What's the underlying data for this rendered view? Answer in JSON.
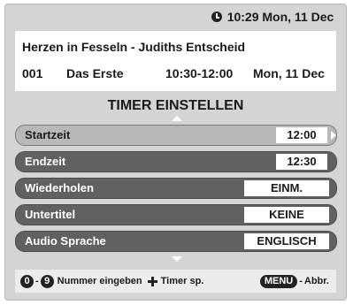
{
  "clock": {
    "time_date": "10:29 Mon, 11 Dec",
    "icon": "clock-icon"
  },
  "program": {
    "title": "Herzen in Fesseln - Judiths Entscheid",
    "channel_number": "001",
    "channel_name": "Das Erste",
    "time_range": "10:30-12:00",
    "date": "Mon, 11 Dec"
  },
  "section_title": "TIMER EINSTELLEN",
  "settings": [
    {
      "label": "Startzeit",
      "value": "12:00",
      "active": true
    },
    {
      "label": "Endzeit",
      "value": "12:30",
      "active": false
    },
    {
      "label": "Wiederholen",
      "value": "EINM.",
      "active": false
    },
    {
      "label": "Untertitel",
      "value": "KEINE",
      "active": false
    },
    {
      "label": "Audio Sprache",
      "value": "ENGLISCH",
      "active": false
    }
  ],
  "footer": {
    "key_zero": "0",
    "key_dash": "-",
    "key_nine": "9",
    "number_label": "Nummer eingeben",
    "dpad_icon": "dpad-icon",
    "save_label": "Timer sp.",
    "menu_key": "MENU",
    "menu_dash": "-",
    "cancel_label": "Abbr."
  },
  "colors": {
    "panel_bg": "#d4d4d4",
    "row_bg": "#616161",
    "row_active_bg": "#b8b8b8",
    "value_bg": "#ffffff"
  }
}
